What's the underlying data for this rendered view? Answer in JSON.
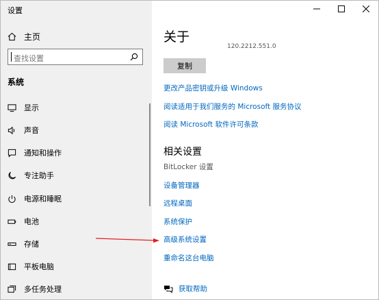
{
  "window": {
    "title": "设置"
  },
  "sidebar": {
    "home_label": "主页",
    "search_placeholder": "查找设置",
    "section_title": "系统",
    "items": [
      {
        "label": "显示",
        "icon": "display-icon"
      },
      {
        "label": "声音",
        "icon": "speaker-icon"
      },
      {
        "label": "通知和操作",
        "icon": "notification-icon"
      },
      {
        "label": "专注助手",
        "icon": "moon-icon"
      },
      {
        "label": "电源和睡眠",
        "icon": "power-icon"
      },
      {
        "label": "电池",
        "icon": "battery-icon"
      },
      {
        "label": "存储",
        "icon": "storage-icon"
      },
      {
        "label": "平板电脑",
        "icon": "tablet-icon"
      },
      {
        "label": "多任务处理",
        "icon": "multitask-icon"
      }
    ]
  },
  "main": {
    "title": "关于",
    "version": "120.2212.551.0",
    "copy_label": "复制",
    "links": [
      "更改产品密钥或升级 Windows",
      "阅读适用于我们服务的 Microsoft 服务协议",
      "阅读 Microsoft 软件许可条款"
    ],
    "related_title": "相关设置",
    "bitlocker": "BitLocker 设置",
    "related_links": [
      "设备管理器",
      "远程桌面",
      "系统保护",
      "高级系统设置",
      "重命名这台电脑"
    ],
    "help_label": "获取帮助"
  },
  "colors": {
    "link": "#0067c0",
    "sidebar_bg": "#f0f0f0",
    "annotation_arrow": "#e02020"
  }
}
